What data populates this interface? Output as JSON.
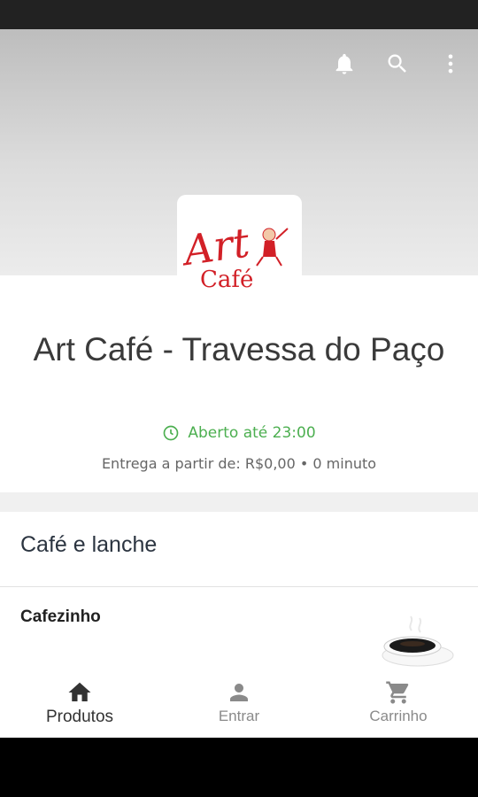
{
  "header": {
    "icons": [
      "bell-icon",
      "search-icon",
      "more-vert-icon"
    ]
  },
  "store": {
    "logo": {
      "line1": "Art",
      "line2": "Café"
    },
    "name": "Art Café - Travessa do Paço",
    "open_status": "Aberto até 23:00",
    "delivery_info": "Entrega a partir de: R$0,00 • 0 minuto"
  },
  "section": {
    "title": "Café e lanche",
    "products": [
      {
        "name": "Cafezinho"
      }
    ]
  },
  "bottom_nav": {
    "items": [
      {
        "label": "Produtos",
        "icon": "home-icon",
        "active": true
      },
      {
        "label": "Entrar",
        "icon": "person-icon",
        "active": false
      },
      {
        "label": "Carrinho",
        "icon": "cart-icon",
        "active": false
      }
    ]
  },
  "colors": {
    "open_green": "#4caf50",
    "logo_red": "#d22027",
    "text_dark": "#3a3a3a"
  }
}
